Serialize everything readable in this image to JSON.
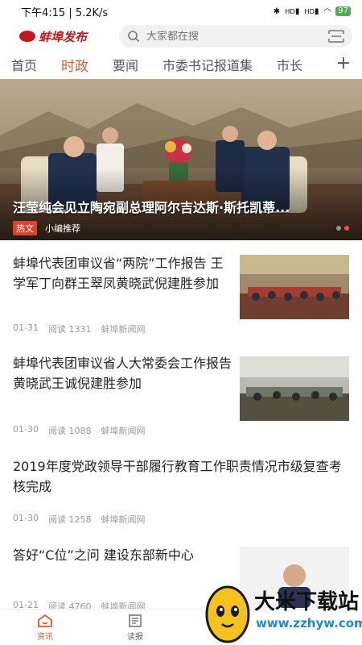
{
  "status_bar": {
    "time_speed": "下午4:15 | 5.2K/s",
    "battery": "97",
    "signal_label_1": "HD",
    "signal_label_2": "HD"
  },
  "header": {
    "logo_text": "蚌埠发布",
    "search_placeholder": "大家都在搜"
  },
  "tabs": [
    "首页",
    "时政",
    "要闻",
    "市委书记报道集",
    "市长"
  ],
  "active_tab": "时政",
  "hero": {
    "title": "汪莹纯会见立陶宛副总理阿尔吉达斯·斯托凯蒂...",
    "badge": "热文",
    "tag": "小编推荐"
  },
  "articles": [
    {
      "title": "蚌埠代表团审议省“两院”工作报告 王学军丁向群王翠凤黄晓武倪建胜参加",
      "date": "01-31",
      "reads": "阅读 1331",
      "source": "蚌埠新闻网"
    },
    {
      "title": "蚌埠代表团审议省人大常委会工作报告 黄晓武王诚倪建胜参加",
      "date": "01-30",
      "reads": "阅读 1088",
      "source": "蚌埠新闻网"
    },
    {
      "title": "2019年度党政领导干部履行教育工作职责情况市级复查考核完成",
      "date": "01-30",
      "reads": "阅读 1258",
      "source": "蚌埠新闻网"
    },
    {
      "title": "答好“C位”之问 建设东部新中心",
      "date": "01-21",
      "reads": "阅读 4760",
      "source": "蚌埠新闻网"
    }
  ],
  "bottom_nav": [
    {
      "label": "资讯",
      "icon": "home-icon"
    },
    {
      "label": "读报",
      "icon": "newspaper-icon"
    }
  ],
  "watermark": {
    "title": "大米下载站",
    "url": "www.zzhyw.com"
  },
  "colors": {
    "accent": "#e8572d",
    "brand_red": "#c8161d"
  }
}
